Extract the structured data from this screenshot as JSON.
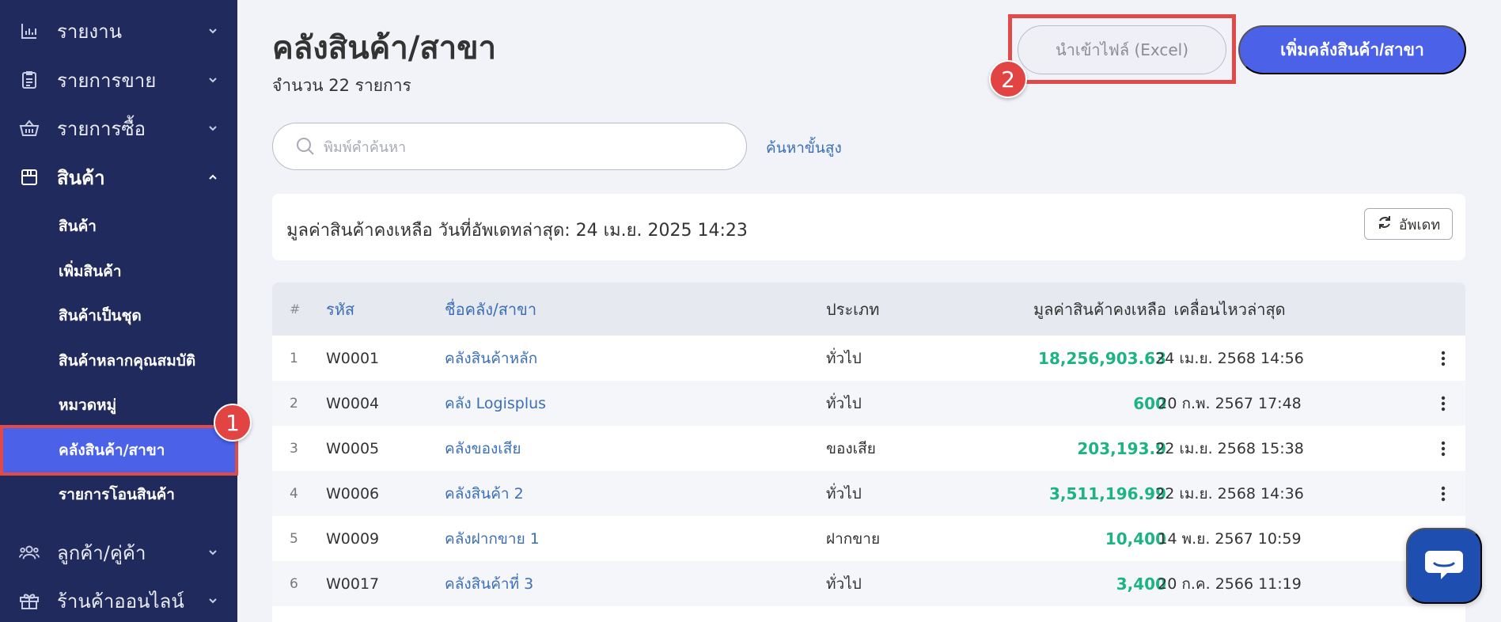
{
  "sidebar": {
    "top_items": [
      {
        "label": "รายงาน",
        "icon": "chart-icon"
      },
      {
        "label": "รายการขาย",
        "icon": "clipboard-icon"
      },
      {
        "label": "รายการซื้อ",
        "icon": "basket-icon"
      },
      {
        "label": "สินค้า",
        "icon": "box-icon"
      }
    ],
    "sub_items": [
      {
        "label": "สินค้า"
      },
      {
        "label": "เพิ่มสินค้า"
      },
      {
        "label": "สินค้าเป็นชุด"
      },
      {
        "label": "สินค้าหลากคุณสมบัติ"
      },
      {
        "label": "หมวดหมู่"
      },
      {
        "label": "คลังสินค้า/สาขา",
        "active": true
      },
      {
        "label": "รายการโอนสินค้า"
      }
    ],
    "bottom_items": [
      {
        "label": "ลูกค้า/คู่ค้า",
        "icon": "users-icon"
      },
      {
        "label": "ร้านค้าออนไลน์",
        "icon": "gift-icon"
      }
    ]
  },
  "badges": {
    "one": "1",
    "two": "2"
  },
  "header": {
    "title": "คลังสินค้า/สาขา",
    "count": "จำนวน 22 รายการ",
    "import_label": "นำเข้าไฟล์ (Excel)",
    "add_label": "เพิ่มคลังสินค้า/สาขา"
  },
  "search": {
    "placeholder": "พิมพ์คำค้นหา",
    "advanced": "ค้นหาขั้นสูง"
  },
  "info": {
    "text": "มูลค่าสินค้าคงเหลือ วันที่อัพเดทล่าสุด: 24 เม.ย. 2025 14:23",
    "refresh_label": "อัพเดท"
  },
  "table": {
    "headers": {
      "idx": "#",
      "code": "รหัส",
      "name": "ชื่อคลัง/สาขา",
      "type": "ประเภท",
      "value": "มูลค่าสินค้าคงเหลือ",
      "time": "เคลื่อนไหวล่าสุด"
    },
    "rows": [
      {
        "idx": "1",
        "code": "W0001",
        "name": "คลังสินค้าหลัก",
        "type": "ทั่วไป",
        "value": "18,256,903.63",
        "time": "24 เม.ย. 2568 14:56"
      },
      {
        "idx": "2",
        "code": "W0004",
        "name": "คลัง Logisplus",
        "type": "ทั่วไป",
        "value": "600",
        "time": "20 ก.พ. 2567 17:48"
      },
      {
        "idx": "3",
        "code": "W0005",
        "name": "คลังของเสีย",
        "type": "ของเสีย",
        "value": "203,193.9",
        "time": "22 เม.ย. 2568 15:38"
      },
      {
        "idx": "4",
        "code": "W0006",
        "name": "คลังสินค้า 2",
        "type": "ทั่วไป",
        "value": "3,511,196.99",
        "time": "22 เม.ย. 2568 14:36"
      },
      {
        "idx": "5",
        "code": "W0009",
        "name": "คลังฝากขาย 1",
        "type": "ฝากขาย",
        "value": "10,400",
        "time": "14 พ.ย. 2567 10:59"
      },
      {
        "idx": "6",
        "code": "W0017",
        "name": "คลังสินค้าที่ 3",
        "type": "ทั่วไป",
        "value": "3,400",
        "time": "20 ก.ค. 2566 11:19"
      }
    ]
  },
  "colors": {
    "sidebar": "#212a5c",
    "accent": "#4a61e8",
    "highlight": "#e24a4a",
    "value_green": "#1db383",
    "link_blue": "#3b6fb6"
  }
}
